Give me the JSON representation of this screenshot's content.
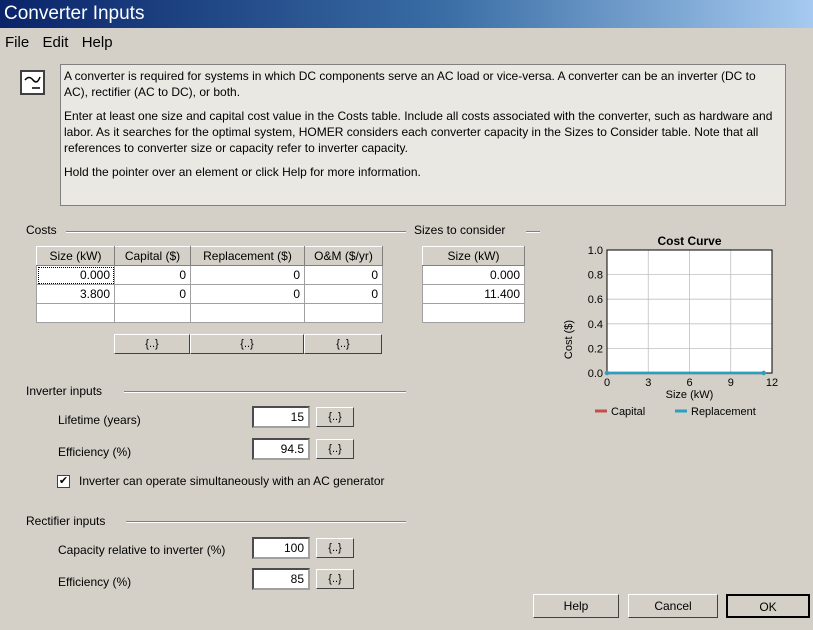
{
  "window": {
    "title": "Converter Inputs"
  },
  "menu": {
    "items": [
      "File",
      "Edit",
      "Help"
    ]
  },
  "info": {
    "p1": "A converter is required for systems in which DC components serve an AC load or vice-versa. A converter can be an inverter (DC to AC), rectifier (AC to DC), or both.",
    "p2": "Enter at least one size and capital cost value in the Costs table. Include all costs associated with the converter, such as hardware and labor. As it searches for the optimal system, HOMER considers each converter capacity in the Sizes to Consider table. Note that all references to converter size or capacity refer to inverter capacity.",
    "p3": "Hold the pointer over an element or click Help for more information."
  },
  "costs": {
    "label": "Costs",
    "headers": [
      "Size (kW)",
      "Capital ($)",
      "Replacement ($)",
      "O&M ($/yr)"
    ],
    "rows": [
      [
        "0.000",
        "0",
        "0",
        "0"
      ],
      [
        "3.800",
        "0",
        "0",
        "0"
      ]
    ],
    "button_label": "{..}"
  },
  "sizes": {
    "label": "Sizes to consider",
    "header": "Size (kW)",
    "rows": [
      "0.000",
      "11.400"
    ]
  },
  "inverter": {
    "label": "Inverter inputs",
    "lifetime_label": "Lifetime (years)",
    "lifetime_value": "15",
    "efficiency_label": "Efficiency (%)",
    "efficiency_value": "94.5",
    "checkbox_label": "Inverter can operate simultaneously with an AC generator",
    "checkbox_checked": true,
    "checkbox_mark": "✔",
    "button_label": "{..}"
  },
  "rectifier": {
    "label": "Rectifier inputs",
    "capacity_label": "Capacity relative to inverter (%)",
    "capacity_value": "100",
    "efficiency_label": "Efficiency (%)",
    "efficiency_value": "85",
    "button_label": "{..}"
  },
  "buttons": {
    "help": "Help",
    "cancel": "Cancel",
    "ok": "OK"
  },
  "chart_data": {
    "type": "line",
    "title": "Cost Curve",
    "xlabel": "Size (kW)",
    "ylabel": "Cost ($)",
    "xlim": [
      0,
      12
    ],
    "ylim": [
      0,
      1.0
    ],
    "xticks": [
      "0",
      "3",
      "6",
      "9",
      "12"
    ],
    "yticks": [
      "0.0",
      "0.2",
      "0.4",
      "0.6",
      "0.8",
      "1.0"
    ],
    "grid": true,
    "legend_position": "bottom",
    "series": [
      {
        "name": "Capital",
        "color": "#c0504d",
        "x": [
          0,
          11.4
        ],
        "y": [
          0,
          0
        ]
      },
      {
        "name": "Replacement",
        "color": "#2aa0c0",
        "x": [
          0,
          11.4
        ],
        "y": [
          0,
          0
        ]
      }
    ]
  }
}
